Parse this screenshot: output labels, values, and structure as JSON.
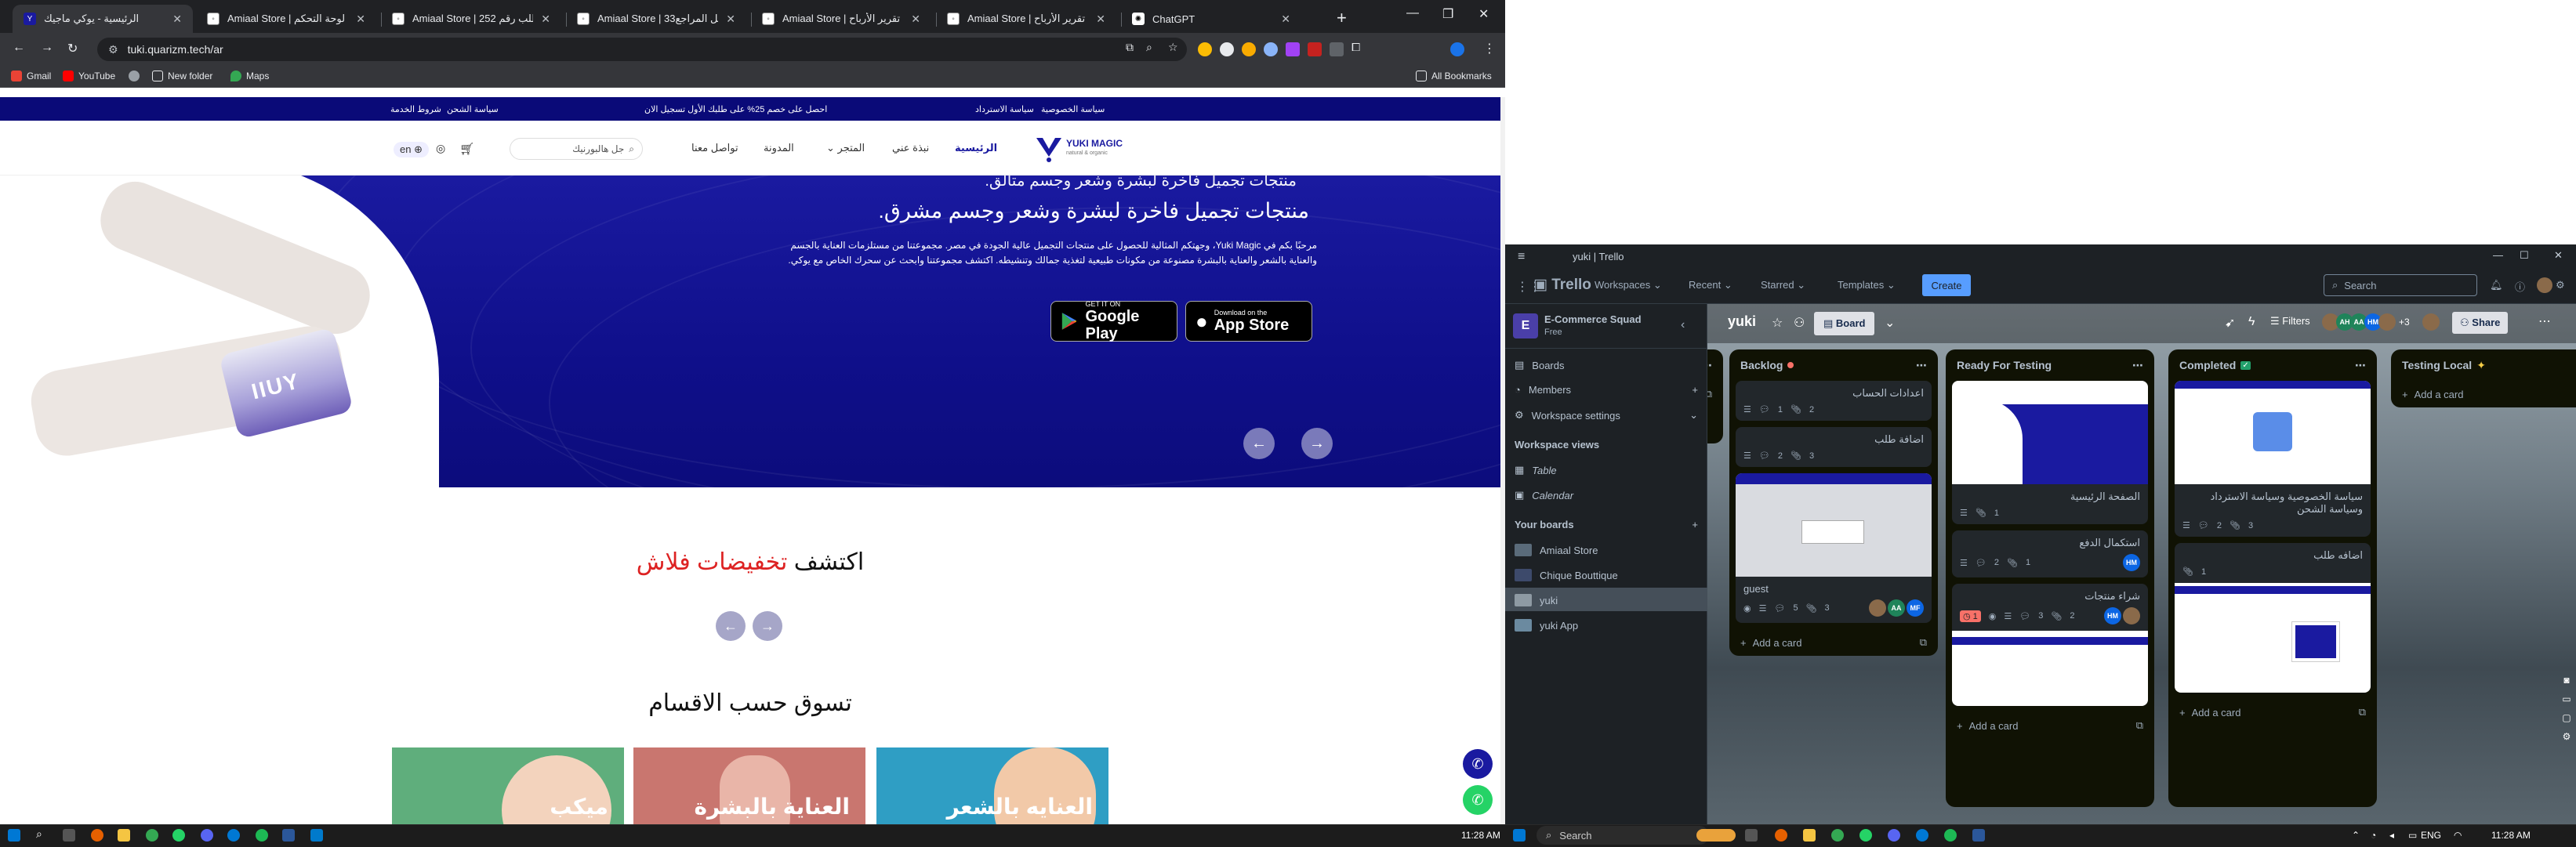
{
  "chrome": {
    "tabs": [
      {
        "title": "الرئيسية - يوكي ماجيك",
        "active": true
      },
      {
        "title": "Amiaal Store | لوحة التحكم"
      },
      {
        "title": "Amiaal Store | تفاصيل الطلب رقم 252"
      },
      {
        "title": "Amiaal Store | تفاصيل المراجع33"
      },
      {
        "title": "Amiaal Store | تقرير الأرباح"
      },
      {
        "title": "Amiaal Store | تقرير الأرباح"
      },
      {
        "title": "ChatGPT"
      }
    ],
    "url": "tuki.quarizm.tech/ar",
    "bookmarks": [
      "Gmail",
      "YouTube",
      "New folder",
      "Maps"
    ],
    "all_bookmarks": "All Bookmarks"
  },
  "site": {
    "announce": {
      "left": "شروط الخدمة",
      "left2": "سياسة الشحن",
      "center": "احصل على خصم 25% على طلبك الأول تسجيل الان",
      "right1": "سياسة الاسترداد",
      "right2": "سياسة الخصوصية"
    },
    "nav": {
      "home": "الرئيسية",
      "about": "نبذة عني",
      "store": "المتجر",
      "blog": "المدونة",
      "contact": "تواصل معنا",
      "search_placeholder": "جل هالبورنيك",
      "lang": "en"
    },
    "logo": {
      "name": "YUKI MAGIC",
      "tagline": "natural & organic"
    },
    "hero": {
      "title_small": "منتجات تجميل فاخرة لبشرة وشعر وجسم متألق.",
      "title": "منتجات تجميل فاخرة لبشرة وشعر وجسم مشرق.",
      "desc": "مرحبًا بكم في Yuki Magic، وجهتكم المثالية للحصول على منتجات التجميل عالية الجودة في مصر. مجموعتنا من مستلزمات العناية بالجسم والعناية بالشعر والعناية بالبشرة مصنوعة من مكونات طبيعية لتغذية جمالك وتنشيطه. اكتشف مجموعتنا وابحث عن سحرك الخاص مع يوكي.",
      "google_small": "GET IT ON",
      "google_big": "Google Play",
      "apple_small": "Download on the",
      "apple_big": "App Store",
      "jar_brand": "IIUY"
    },
    "flash": {
      "part1": "اكتشف",
      "part2": "تخفيضات فلاش"
    },
    "shop_by": "تسوق حسب الاقسام",
    "categories": [
      {
        "label": "العنايه بالشعر",
        "color": "#2f9ec4"
      },
      {
        "label": "العناية بالبشرة",
        "color": "#c9766f"
      },
      {
        "label": "ميكب",
        "color": "#5fae7c"
      }
    ]
  },
  "trello": {
    "window_title": "yuki | Trello",
    "brand": "Trello",
    "menus": [
      "Workspaces",
      "Recent",
      "Starred",
      "Templates"
    ],
    "create": "Create",
    "search": "Search",
    "workspace": {
      "initial": "E",
      "name": "E-Commerce Squad",
      "plan": "Free"
    },
    "sidebar": {
      "boards": "Boards",
      "members": "Members",
      "settings": "Workspace settings",
      "views_title": "Workspace views",
      "table": "Table",
      "calendar": "Calendar",
      "your_boards": "Your boards",
      "board_list": [
        "Amiaal Store",
        "Chique Bouttique",
        "yuki",
        "yuki App"
      ]
    },
    "board": {
      "name": "yuki",
      "view": "Board",
      "filters": "Filters",
      "share": "Share",
      "extra_members": "+3"
    },
    "lists": [
      {
        "name": "Backlog",
        "cards": [
          {
            "title": "اعدادات الحساب",
            "comments": "1",
            "attach": "2"
          },
          {
            "title": "اضافة طلب",
            "comments": "2",
            "attach": "3"
          },
          {
            "title": "guest",
            "comments": "5",
            "attach": "3"
          }
        ],
        "add": "Add a card"
      },
      {
        "name": "Ready For Testing",
        "cards": [
          {
            "title": "الصفحة الرئيسية",
            "attach": "1"
          },
          {
            "title": "استكمال الدفع",
            "comments": "2",
            "attach": "1"
          },
          {
            "title": "شراء منتجات",
            "due": "1",
            "comments": "3",
            "attach": "2"
          }
        ],
        "add": "Add a card"
      },
      {
        "name": "Completed",
        "cards": [
          {
            "title": "سياسة الخصوصية وسياسة الاسترداد وسياسة الشحن",
            "comments": "2",
            "attach": "3"
          },
          {
            "title": "اضافه طلب",
            "attach": "1"
          }
        ],
        "add": "Add a card"
      },
      {
        "name": "Testing Local",
        "cards": [],
        "add": "Add a card"
      }
    ]
  },
  "taskbar": {
    "search": "Search",
    "time_left": "11:28 AM",
    "lang": "ENG",
    "time_right": "11:28 AM"
  }
}
